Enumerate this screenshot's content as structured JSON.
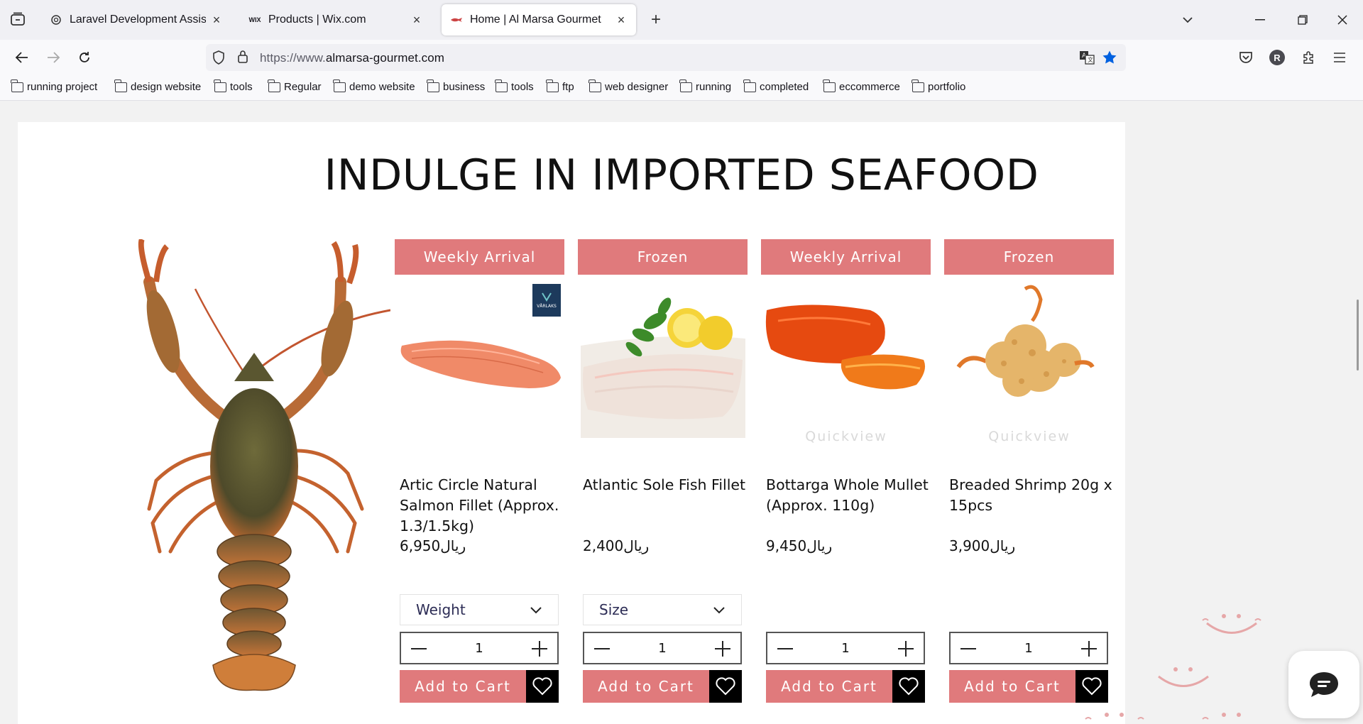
{
  "browser": {
    "tabs": [
      {
        "title": "Laravel Development Assistance",
        "favicon": "openai-icon",
        "active": false
      },
      {
        "title": "Products | Wix.com",
        "favicon": "wix-icon",
        "favicon_text": "WIX",
        "active": false
      },
      {
        "title": "Home | Al Marsa Gourmet",
        "favicon": "site-icon",
        "active": true
      }
    ],
    "url_prefix": "https://www.",
    "url_domain": "almarsa-gourmet.com",
    "profile_initial": "R",
    "bookmarks": [
      "running project",
      "design website",
      "tools",
      "Regular",
      "demo website",
      "business",
      "tools",
      "ftp",
      "web designer",
      "running",
      "completed",
      "eccommerce",
      "portfolio"
    ]
  },
  "page": {
    "headline": "INDULGE IN IMPORTED SEAFOOD",
    "quickview_label": "Quickview",
    "add_to_cart_label": "Add to Cart",
    "products": [
      {
        "ribbon": "Weekly Arrival",
        "name": "Artic Circle Natural Salmon Fillet (Approx. 1.3/1.5kg)",
        "price": "6,950ريال",
        "option_label": "Weight",
        "quantity": "1",
        "brand_badge": "VÅRLAKS"
      },
      {
        "ribbon": "Frozen",
        "name": "Atlantic Sole Fish Fillet",
        "price": "2,400ريال",
        "option_label": "Size",
        "quantity": "1"
      },
      {
        "ribbon": "Weekly Arrival",
        "name": "Bottarga Whole Mullet (Approx. 110g)",
        "price": "9,450ريال",
        "option_label": "",
        "quantity": "1",
        "quickview": true
      },
      {
        "ribbon": "Frozen",
        "name": "Breaded Shrimp 20g x 15pcs",
        "price": "3,900ريال",
        "option_label": "",
        "quantity": "1",
        "quickview": true
      }
    ]
  },
  "colors": {
    "accent": "#e07a7c",
    "wishlist_bg": "#000000",
    "text": "#111111"
  }
}
